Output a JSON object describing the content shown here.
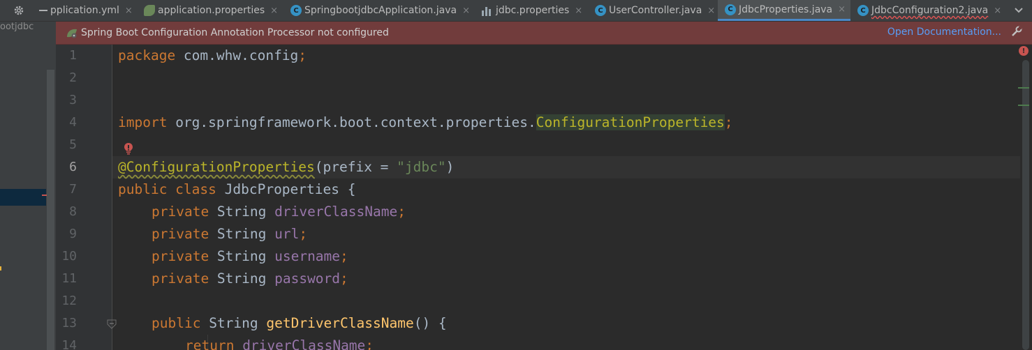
{
  "tabbar": {
    "settings_icon": "gear-icon",
    "collapse_icon": "minus-icon",
    "more_icon": "chevron-down-icon",
    "tabs": [
      {
        "label": "pplication.yml",
        "icon": "spring-leaf-icon",
        "close": "×",
        "active": false
      },
      {
        "label": "application.properties",
        "icon": "spring-leaf-icon",
        "close": "×",
        "active": false
      },
      {
        "label": "SpringbootjdbcApplication.java",
        "icon": "spring-class-icon",
        "close": "×",
        "active": false
      },
      {
        "label": "jdbc.properties",
        "icon": "properties-file-icon",
        "close": "×",
        "active": false
      },
      {
        "label": "UserController.java",
        "icon": "java-class-icon",
        "close": "×",
        "active": false
      },
      {
        "label": "JdbcProperties.java",
        "icon": "java-class-icon",
        "close": "×",
        "active": true
      },
      {
        "label": "JdbcConfiguration2.java",
        "icon": "java-class-icon",
        "close": "×",
        "active": false
      }
    ]
  },
  "left_panel": {
    "label": "ootjdbc"
  },
  "banner": {
    "message": "Spring Boot Configuration Annotation Processor not configured",
    "link": "Open Documentation...",
    "icon": "spring-leaf-icon",
    "action_icon": "wrench-icon",
    "color": "#713c3c"
  },
  "editor": {
    "current_line": 6,
    "line_numbers": [
      "1",
      "2",
      "3",
      "4",
      "5",
      "6",
      "7",
      "8",
      "9",
      "10",
      "11",
      "12",
      "13",
      "14"
    ],
    "lines": {
      "l1": {
        "kw": "package",
        "rest": " com.whw.config",
        "semi": ";"
      },
      "l4": {
        "kw": "import",
        "pkg": " org.springframework.boot.context.properties.",
        "cls": "ConfigurationProperties",
        "semi": ";"
      },
      "l6": {
        "ann": "@ConfigurationProperties",
        "open": "(prefix = ",
        "str": "\"jdbc\"",
        "close": ")"
      },
      "l7": {
        "kw": "public class ",
        "name": "JdbcProperties {"
      },
      "l8": {
        "kw": "private ",
        "type": "String ",
        "field": "driverClassName",
        "semi": ";"
      },
      "l9": {
        "kw": "private ",
        "type": "String ",
        "field": "url",
        "semi": ";"
      },
      "l10": {
        "kw": "private ",
        "type": "String ",
        "field": "username",
        "semi": ";"
      },
      "l11": {
        "kw": "private ",
        "type": "String ",
        "field": "password",
        "semi": ";"
      },
      "l13": {
        "kw": "public ",
        "type": "String ",
        "fn": "getDriverClassName",
        "rest": "() {"
      },
      "l14": {
        "kw": "return ",
        "field": "driverClassName",
        "semi": ";"
      }
    },
    "error_stripe_icon": "error-icon",
    "bulb_icon": "error-bulb-icon",
    "fold_icon": "fold-icon"
  },
  "colors": {
    "keyword": "#cc7832",
    "string": "#6a8759",
    "field": "#9876aa",
    "annotation": "#bbb529",
    "method": "#ffc66d",
    "active_tab_underline": "#4a88c7"
  }
}
